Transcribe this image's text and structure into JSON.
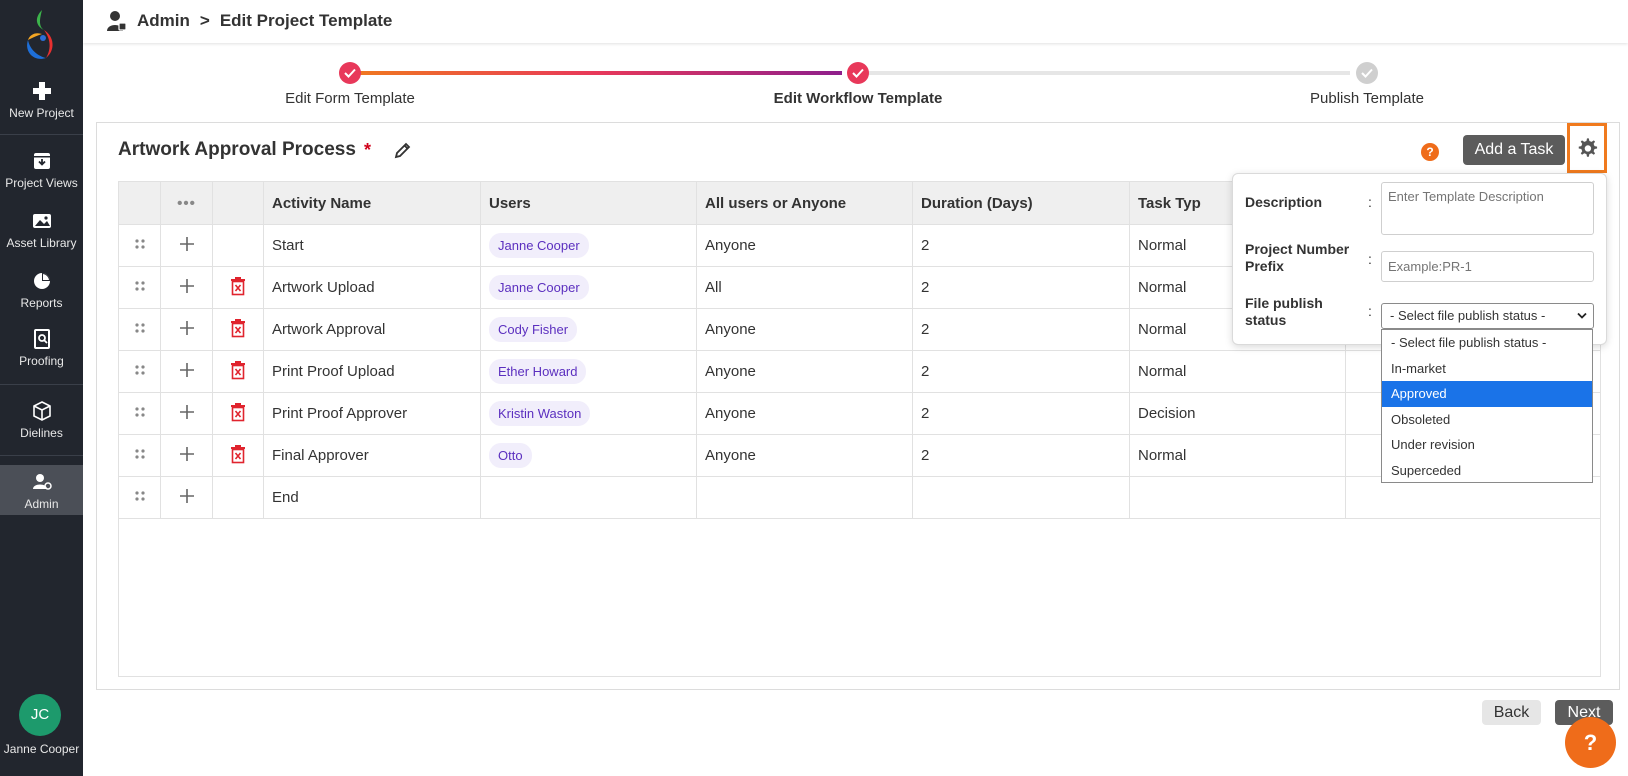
{
  "breadcrumb": {
    "root": "Admin",
    "separator": ">",
    "current": "Edit Project Template"
  },
  "sidebar": {
    "items": [
      {
        "label": "New Project",
        "icon": "plus-icon"
      },
      {
        "label": "Project Views",
        "icon": "inbox-icon"
      },
      {
        "label": "Asset Library",
        "icon": "image-icon"
      },
      {
        "label": "Reports",
        "icon": "pie-chart-icon"
      },
      {
        "label": "Proofing",
        "icon": "proof-search-icon"
      },
      {
        "label": "Dielines",
        "icon": "box-icon"
      },
      {
        "label": "Admin",
        "icon": "admin-user-icon"
      }
    ],
    "user": {
      "initials": "JC",
      "name": "Janne Cooper"
    }
  },
  "stepper": {
    "steps": [
      {
        "label": "Edit Form Template",
        "status": "done"
      },
      {
        "label": "Edit Workflow Template",
        "status": "current"
      },
      {
        "label": "Publish Template",
        "status": "pending"
      }
    ]
  },
  "card": {
    "title": "Artwork Approval Process",
    "required_mark": "*",
    "help": "?",
    "add_task_label": "Add a Task"
  },
  "table": {
    "more": "•••",
    "columns": [
      "Activity Name",
      "Users",
      "All users or Anyone",
      "Duration (Days)",
      "Task Typ"
    ],
    "rows": [
      {
        "activity": "Start",
        "user": "Janne Cooper",
        "mode": "Anyone",
        "duration": "2",
        "type": "Normal",
        "deletable": false
      },
      {
        "activity": "Artwork Upload",
        "user": "Janne Cooper",
        "mode": "All",
        "duration": "2",
        "type": "Normal",
        "deletable": true
      },
      {
        "activity": "Artwork Approval",
        "user": "Cody Fisher",
        "mode": "Anyone",
        "duration": "2",
        "type": "Normal",
        "deletable": true
      },
      {
        "activity": "Print Proof Upload",
        "user": "Ether Howard",
        "mode": "Anyone",
        "duration": "2",
        "type": "Normal",
        "deletable": true
      },
      {
        "activity": "Print Proof Approver",
        "user": "Kristin Waston",
        "mode": "Anyone",
        "duration": "2",
        "type": "Decision",
        "deletable": true
      },
      {
        "activity": "Final Approver",
        "user": "Otto",
        "mode": "Anyone",
        "duration": "2",
        "type": "Normal",
        "deletable": true
      },
      {
        "activity": "End",
        "user": "",
        "mode": "",
        "duration": "",
        "type": "",
        "deletable": false
      }
    ]
  },
  "settings_popover": {
    "description_label": "Description",
    "description_placeholder": "Enter Template Description",
    "prefix_label_line1": "Project Number",
    "prefix_label_line2": "Prefix",
    "prefix_placeholder": "Example:PR-1",
    "publish_label_line1": "File publish",
    "publish_label_line2": "status",
    "colon": ":",
    "publish_selected": "- Select file publish status -",
    "publish_options": [
      "- Select file publish status -",
      "In-market",
      "Approved",
      "Obsoleted",
      "Under revision",
      "Superceded"
    ],
    "highlighted_option": "Approved"
  },
  "footer": {
    "back_label": "Back",
    "next_label": "Next",
    "help_label": "?"
  },
  "colors": {
    "accent": "#ef6c1a",
    "sidebar": "#22262e",
    "step_done": "#e8385a",
    "step_gradient_end": "#8e1f8c",
    "chip_text": "#5b2fbf"
  }
}
